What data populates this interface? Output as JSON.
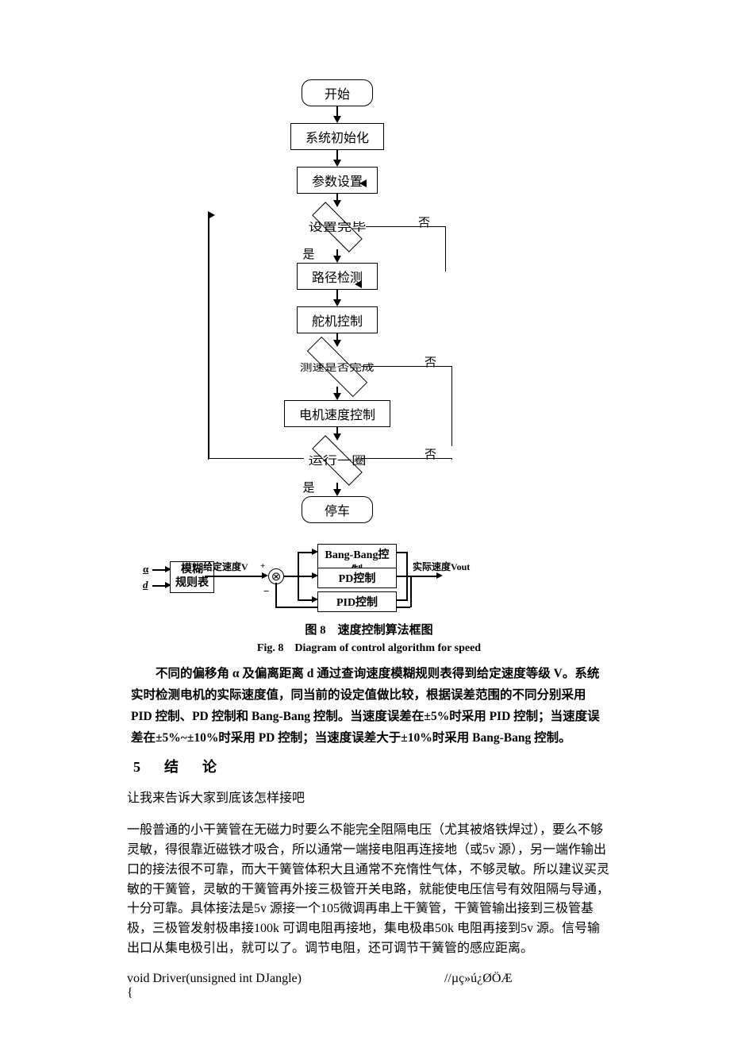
{
  "flowchart": {
    "start": "开始",
    "init": "系统初始化",
    "params": "参数设置",
    "dec1": "设置完毕",
    "dec1_yes": "是",
    "dec1_no": "否",
    "path_detect": "路径检测",
    "servo": "舵机控制",
    "dec2": "测速是否完成",
    "dec2_no": "否",
    "motor": "电机速度控制",
    "dec3": "运行一圈",
    "dec3_yes": "是",
    "dec3_no": "否",
    "stop": "停车"
  },
  "block": {
    "alpha": "α",
    "d": "d",
    "fuzzy": "模糊\n规则表",
    "given_v": "给定速度V",
    "plus": "+",
    "minus": "−",
    "sum": "⊗",
    "bangbang": "Bang-Bang控制",
    "pd": "PD控制",
    "pid": "PID控制",
    "out_label": "实际速度Vout"
  },
  "caption": {
    "cn": "图 8　速度控制算法框图",
    "en": "Fig. 8　Diagram of control algorithm for speed"
  },
  "paragraph1": "不同的偏移角 α 及偏离距离 d 通过查询速度模糊规则表得到给定速度等级 V。系统实时检测电机的实际速度值，同当前的设定值做比较，根据误差范围的不同分别采用 PID 控制、PD 控制和 Bang-Bang 控制。当速度误差在±5%时采用 PID 控制；当速度误差在±5%~±10%时采用 PD 控制；当速度误差大于±10%时采用 Bang-Bang 控制。",
  "heading5": "5　结　论",
  "advice_intro": "让我来告诉大家到底该怎样接吧",
  "advice_body": "一般普通的小干簧管在无磁力时要么不能完全阻隔电压（尤其被烙铁焊过），要么不够灵敏，得很靠近磁铁才吸合，所以通常一端接电阻再连接地（或5v 源），另一端作输出口的接法很不可靠，而大干簧管体积大且通常不充惰性气体，不够灵敏。所以建议买灵敏的干簧管，灵敏的干簧管再外接三极管开关电路，就能使电压信号有效阻隔与导通，十分可靠。具体接法是5v 源接一个105微调再串上干簧管，干簧管输出接到三极管基极，三极管发射极串接100k 可调电阻再接地，集电极串50k 电阻再接到5v 源。信号输出口从集电极引出，就可以了。调节电阻，还可调节干簧管的感应距离。",
  "code_line": "void Driver(unsigned int DJangle)",
  "code_comment": "//µç»ú¿ØÖÆ",
  "brace": "{"
}
